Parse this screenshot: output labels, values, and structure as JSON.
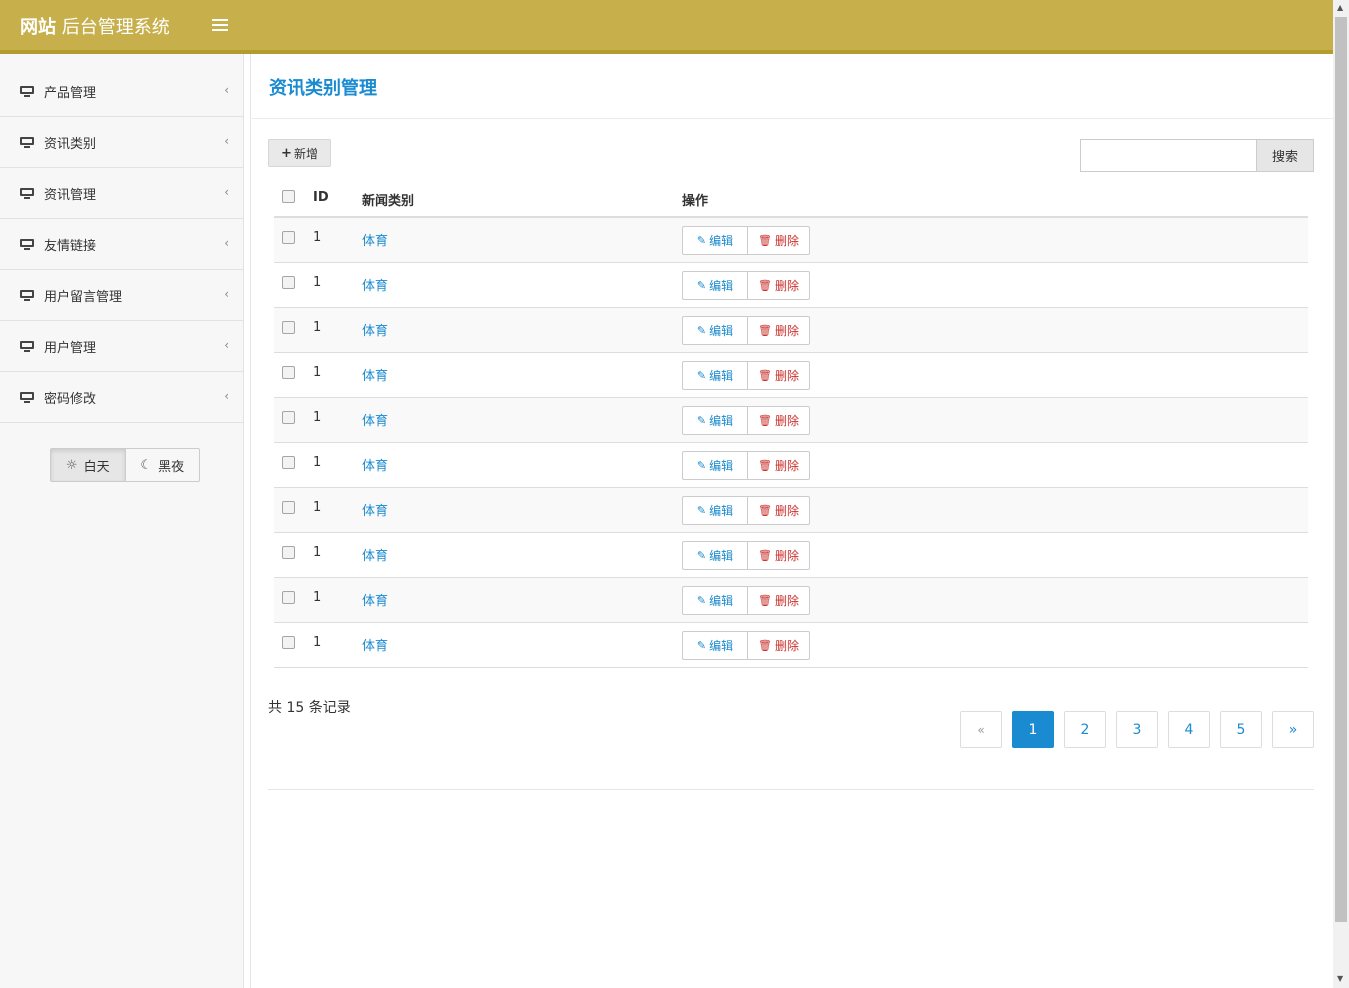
{
  "header": {
    "brand_bold": "网站",
    "brand_rest": " 后台管理系统",
    "menu_icon": "hamburger-icon"
  },
  "sidebar": {
    "items": [
      {
        "label": "产品管理",
        "icon": "monitor-icon"
      },
      {
        "label": "资讯类别",
        "icon": "monitor-icon"
      },
      {
        "label": "资讯管理",
        "icon": "monitor-icon"
      },
      {
        "label": "友情链接",
        "icon": "monitor-icon"
      },
      {
        "label": "用户留言管理",
        "icon": "monitor-icon"
      },
      {
        "label": "用户管理",
        "icon": "monitor-icon"
      },
      {
        "label": "密码修改",
        "icon": "monitor-icon"
      }
    ],
    "chevron": "‹",
    "theme": {
      "day_label": "白天",
      "night_label": "黑夜",
      "active": "day"
    }
  },
  "main": {
    "title": "资讯类别管理",
    "add_label": "新增",
    "search": {
      "placeholder": "",
      "button": "搜索"
    },
    "table": {
      "columns": {
        "id": "ID",
        "category": "新闻类别",
        "ops": "操作"
      },
      "edit_label": "编辑",
      "delete_label": "删除",
      "rows": [
        {
          "id": "1",
          "category": "体育"
        },
        {
          "id": "1",
          "category": "体育"
        },
        {
          "id": "1",
          "category": "体育"
        },
        {
          "id": "1",
          "category": "体育"
        },
        {
          "id": "1",
          "category": "体育"
        },
        {
          "id": "1",
          "category": "体育"
        },
        {
          "id": "1",
          "category": "体育"
        },
        {
          "id": "1",
          "category": "体育"
        },
        {
          "id": "1",
          "category": "体育"
        },
        {
          "id": "1",
          "category": "体育"
        }
      ]
    },
    "record_count": "共 15 条记录",
    "pagination": {
      "prev": "«",
      "pages": [
        "1",
        "2",
        "3",
        "4",
        "5"
      ],
      "next": "»",
      "current": "1"
    }
  },
  "colors": {
    "header": "#c7b04b",
    "accent": "#1a8bd0",
    "danger": "#c9302c"
  }
}
